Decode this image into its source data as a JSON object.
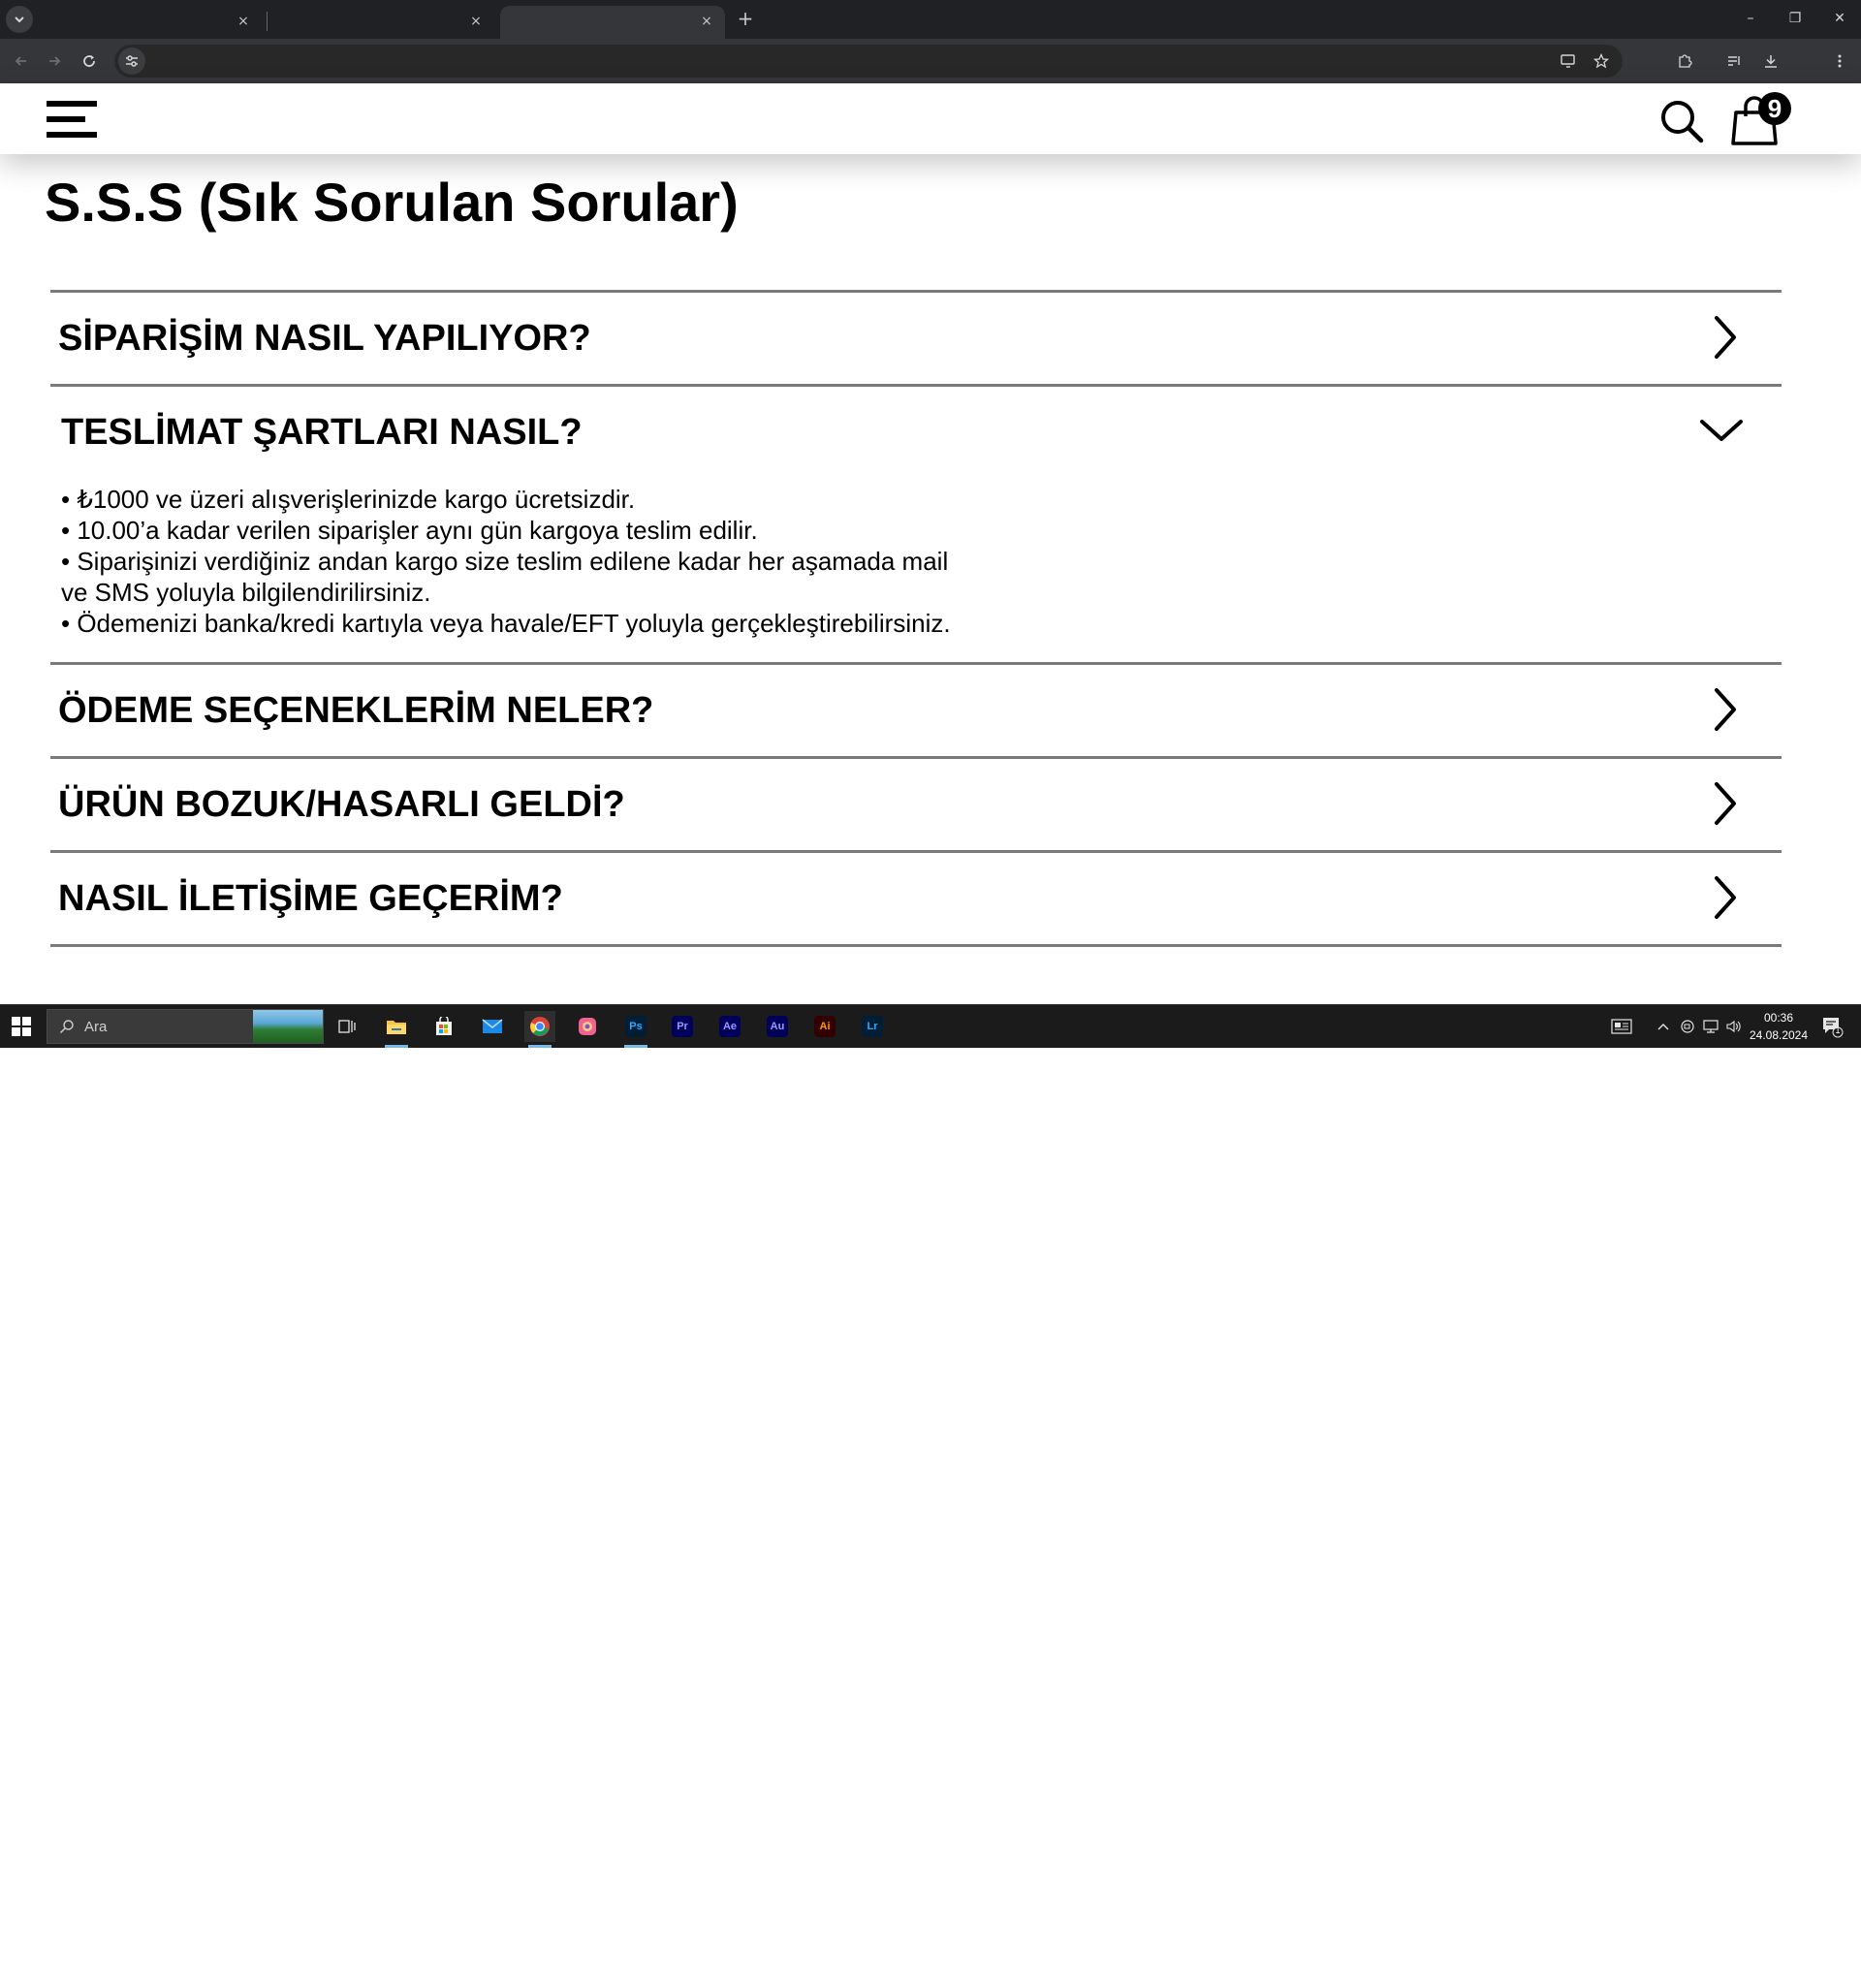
{
  "browser": {
    "tabs": [
      {
        "title": "",
        "active": false
      },
      {
        "title": "",
        "active": false
      },
      {
        "title": "",
        "active": true
      }
    ],
    "close_glyph": "×",
    "new_tab_glyph": "+",
    "window_controls": {
      "minimize": "–",
      "restore": "❐",
      "close": "✕"
    },
    "url": ""
  },
  "site": {
    "cart_count": "9",
    "icons": [
      "menu-icon",
      "search-icon",
      "shopping-bag-icon"
    ]
  },
  "page": {
    "title": "S.S.S (Sık Sorulan Sorular)"
  },
  "faq": {
    "items": [
      {
        "question": "SİPARİŞİM NASIL YAPILIYOR?",
        "open": false
      },
      {
        "question": "TESLİMAT ŞARTLARI NASIL?",
        "open": true,
        "answer": [
          "• ₺1000 ve üzeri alışverişlerinizde kargo ücretsizdir.",
          "• 10.00’a kadar verilen siparişler aynı gün kargoya teslim edilir.",
          "• Siparişinizi verdiğiniz andan kargo size teslim edilene kadar her aşamada mail ve SMS yoluyla bilgilendirilirsiniz.",
          "• Ödemenizi banka/kredi kartıyla veya havale/EFT yoluyla gerçekleştirebilirsiniz."
        ]
      },
      {
        "question": "ÖDEME SEÇENEKLERİM NELER?",
        "open": false
      },
      {
        "question": "ÜRÜN BOZUK/HASARLI GELDİ?",
        "open": false
      },
      {
        "question": "NASIL İLETİŞİME GEÇERİM?",
        "open": false
      }
    ]
  },
  "taskbar": {
    "search_placeholder": "Ara",
    "apps": [
      "task-view",
      "file-explorer",
      "microsoft-store",
      "mail",
      "chrome",
      "photos",
      "Ps",
      "Pr",
      "Ae",
      "Au",
      "Ai",
      "Lr"
    ],
    "adobe_labels": {
      "ps": "Ps",
      "pr": "Pr",
      "ae": "Ae",
      "au": "Au",
      "ai": "Ai",
      "lr": "Lr"
    },
    "time": "00:36",
    "date": "24.08.2024",
    "notification_count": "1"
  },
  "colors": {
    "chrome_dark": "#202124",
    "toolbar": "#35363a",
    "divider": "#7a7a7a",
    "text": "#000000",
    "taskbar": "#1b1b1b"
  }
}
